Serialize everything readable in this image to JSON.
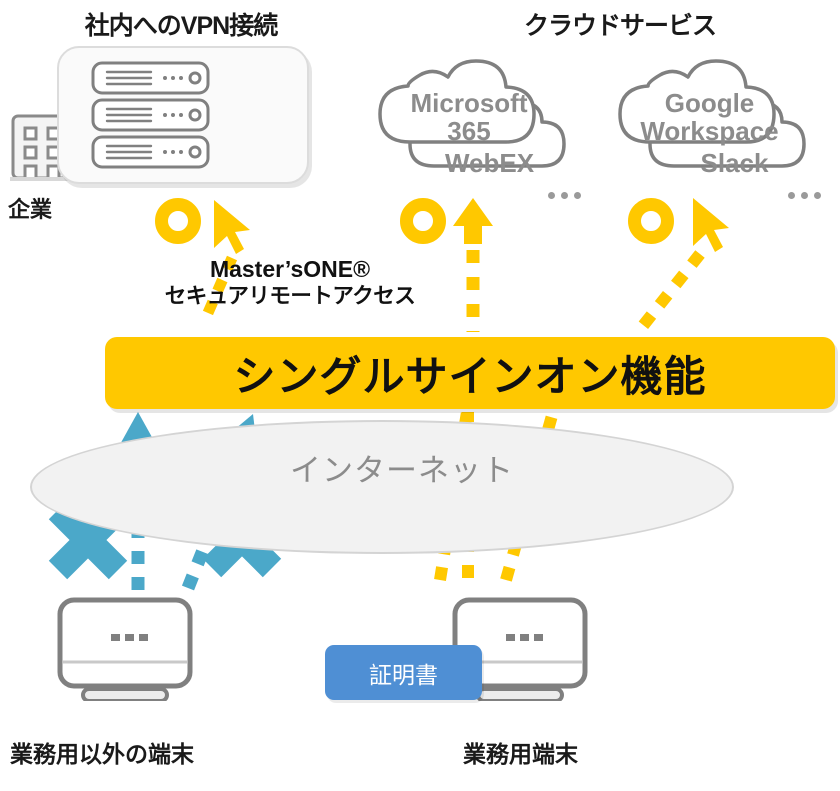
{
  "colors": {
    "yellow": "#FFC800",
    "teal": "#4BA8C9",
    "cert_blue": "#4F8FD4",
    "gray_stroke": "#808080",
    "text_gray": "#8c8c8c",
    "internet_fill": "#f2f2f2"
  },
  "headings": {
    "vpn": "社内へのVPN接続",
    "cloud": "クラウドサービス"
  },
  "enterprise": {
    "label": "企業",
    "icon": "building-icon"
  },
  "vpn_box": {
    "icon": "server-rack-icon",
    "server_count": 3
  },
  "clouds": [
    {
      "front_label": "Microsoft\n365",
      "back_label": "WebEX",
      "dots": "..."
    },
    {
      "front_label": "Google\nWorkspace",
      "back_label": "Slack",
      "dots": "..."
    }
  ],
  "brand": {
    "line1": "Master’sONE®",
    "line2": "セキュアリモートアクセス"
  },
  "sso": {
    "label": "シングルサインオン機能"
  },
  "internet": {
    "label": "インターネット"
  },
  "devices": [
    {
      "label": "業務用以外の端末",
      "icon": "monitor-icon",
      "blocked": true
    },
    {
      "label": "業務用端末",
      "icon": "monitor-icon",
      "blocked": false
    }
  ],
  "certificate": {
    "label": "証明書"
  },
  "connections": {
    "blocked_marker": "x-mark",
    "allowed_arrow": "arrow-up",
    "cursor": "cursor-icon",
    "ring": "ring-icon"
  }
}
